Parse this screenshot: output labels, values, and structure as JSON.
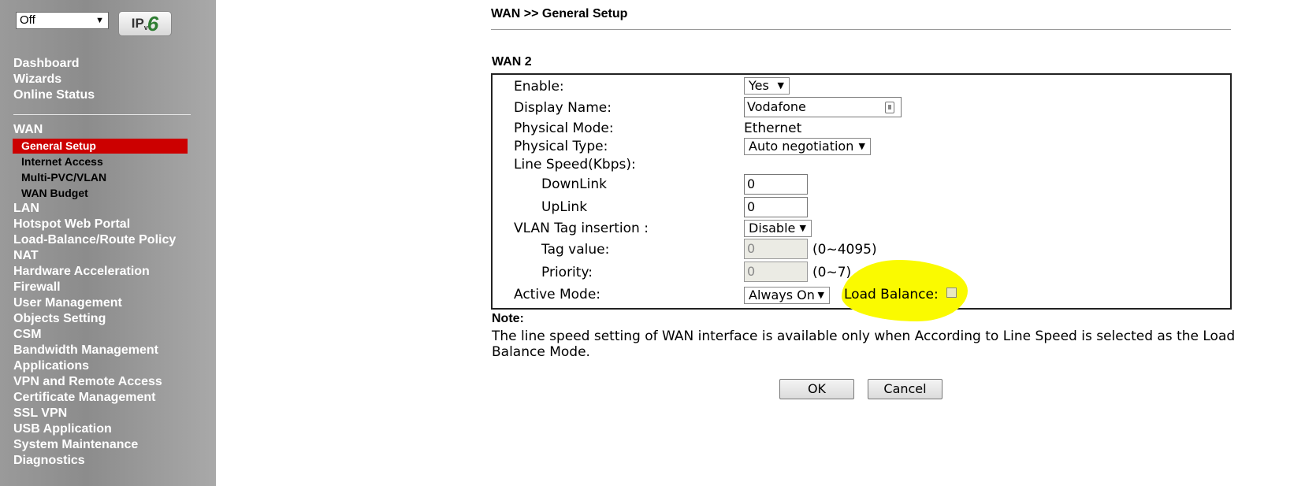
{
  "sidebar": {
    "top_select_value": "Off",
    "ipv6_button": {
      "ip": "IP",
      "v": "v",
      "six": "6"
    },
    "main_items": [
      "Dashboard",
      "Wizards",
      "Online Status"
    ],
    "wan_label": "WAN",
    "wan_sub_items": [
      "General Setup",
      "Internet Access",
      "Multi-PVC/VLAN",
      "WAN Budget"
    ],
    "active_sub_item": "General Setup",
    "other_items": [
      "LAN",
      "Hotspot Web Portal",
      "Load-Balance/Route Policy",
      "NAT",
      "Hardware Acceleration",
      "Firewall",
      "User Management",
      "Objects Setting",
      "CSM",
      "Bandwidth Management",
      "Applications",
      "VPN and Remote Access",
      "Certificate Management",
      "SSL VPN",
      "USB Application",
      "System Maintenance",
      "Diagnostics"
    ]
  },
  "header": {
    "title": "WAN >> General Setup"
  },
  "section": {
    "title": "WAN 2"
  },
  "form": {
    "enable_label": "Enable:",
    "enable_value": "Yes",
    "display_name_label": "Display Name:",
    "display_name_value": "Vodafone",
    "physical_mode_label": "Physical Mode:",
    "physical_mode_value": "Ethernet",
    "physical_type_label": "Physical Type:",
    "physical_type_value": "Auto negotiation",
    "line_speed_label": "Line Speed(Kbps):",
    "downlink_label": "DownLink",
    "downlink_value": "0",
    "uplink_label": "UpLink",
    "uplink_value": "0",
    "vlan_tag_label": "VLAN Tag insertion :",
    "vlan_tag_value": "Disable",
    "tag_value_label": "Tag value:",
    "tag_value_value": "0",
    "tag_value_range": "(0~4095)",
    "priority_label": "Priority:",
    "priority_value": "0",
    "priority_range": "(0~7)",
    "active_mode_label": "Active Mode:",
    "active_mode_value": "Always On",
    "load_balance_label": "Load Balance:",
    "load_balance_checked": false
  },
  "note": {
    "title": "Note:",
    "text": "The line speed setting of WAN interface is available only when According to Line Speed is selected as the Load Balance Mode."
  },
  "buttons": {
    "ok": "OK",
    "cancel": "Cancel"
  },
  "colors": {
    "active_nav": "#cc0000",
    "highlight": "#fafa00",
    "ipv6_green": "#2e7d32"
  }
}
